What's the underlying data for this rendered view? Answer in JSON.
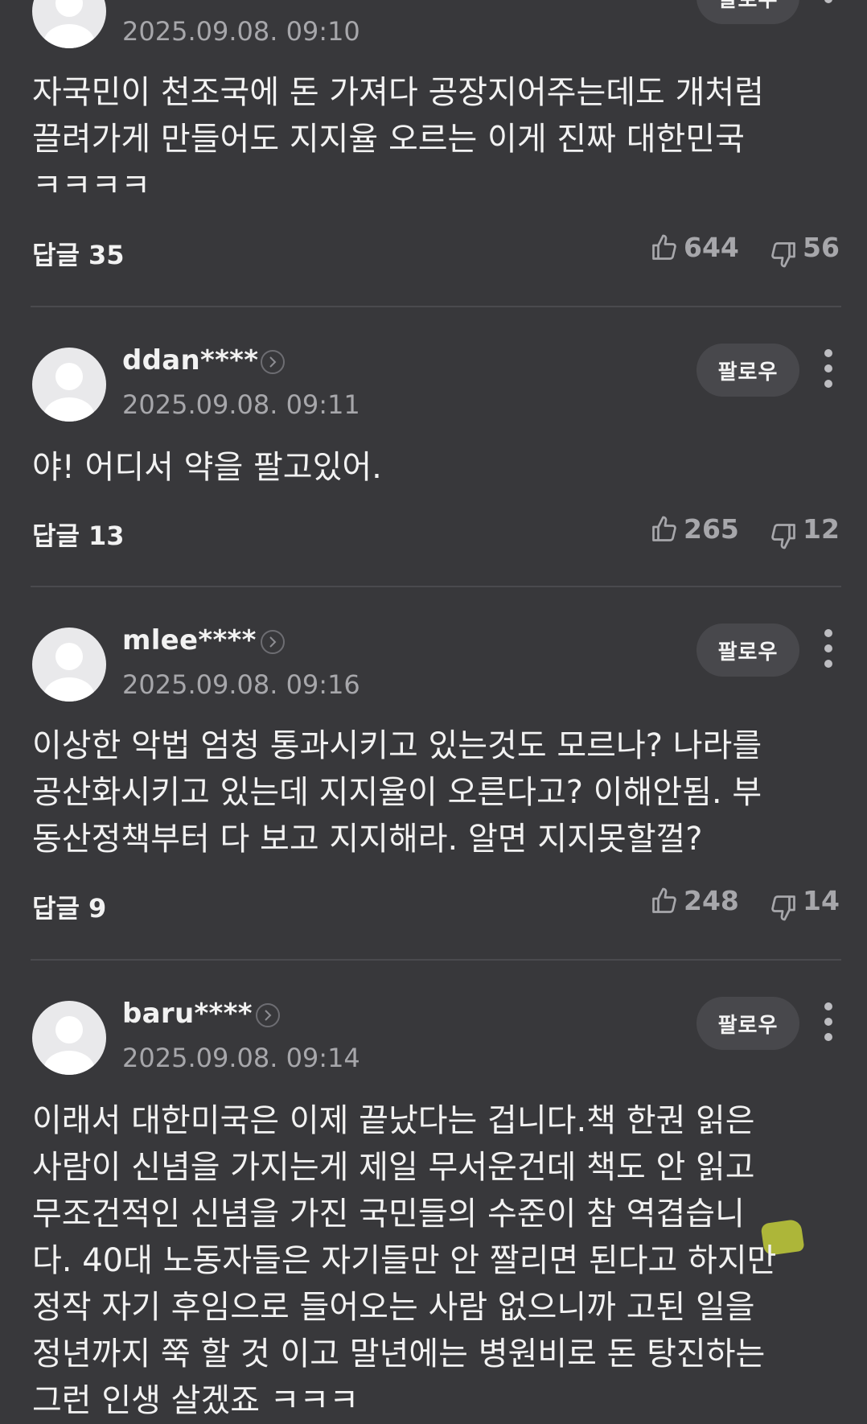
{
  "comments": [
    {
      "timestamp": "2025.09.08. 09:10",
      "follow_label": "팔로우",
      "body": "자국민이 천조국에 돈 가져다 공장지어주는데도 개처럼\n끌려가게 만들어도 지지율 오르는 이게 진짜 대한민국\nㅋㅋㅋㅋ",
      "reply_label": "답글 35",
      "likes": "644",
      "dislikes": "56"
    },
    {
      "username": "ddan****",
      "timestamp": "2025.09.08. 09:11",
      "follow_label": "팔로우",
      "body": "야! 어디서 약을 팔고있어.",
      "reply_label": "답글 13",
      "likes": "265",
      "dislikes": "12"
    },
    {
      "username": "mlee****",
      "timestamp": "2025.09.08. 09:16",
      "follow_label": "팔로우",
      "body": "이상한 악법 엄청 통과시키고 있는것도 모르나? 나라를\n공산화시키고 있는데 지지율이 오른다고? 이해안됨. 부\n동산정책부터 다 보고 지지해라. 알면 지지못할껄?",
      "reply_label": "답글 9",
      "likes": "248",
      "dislikes": "14"
    },
    {
      "username": "baru****",
      "timestamp": "2025.09.08. 09:14",
      "follow_label": "팔로우",
      "body": "이래서 대한미국은 이제 끝났다는 겁니다.책 한권 읽은\n사람이 신념을 가지는게 제일 무서운건데 책도 안 읽고\n무조건적인 신념을 가진 국민들의 수준이 참 역겹습니\n다. 40대 노동자들은 자기들만 안 짤리면 된다고 하지만\n정작 자기 후임으로 들어오는 사람 없으니까 고된 일을\n정년까지 쭉 할 것 이고 말년에는 병원비로 돈 탕진하는\n그런 인생 살겠죠 ㅋㅋㅋ"
    }
  ],
  "colors": {
    "background": "#38383b",
    "text": "#f2f2f2",
    "muted": "#a7a7ab",
    "follow_bg": "#48484c",
    "highlight": "#c2cd3a"
  },
  "icons": [
    "avatar-icon",
    "chevron-right-icon",
    "thumbs-up-icon",
    "thumbs-down-icon",
    "more-vertical-icon"
  ]
}
